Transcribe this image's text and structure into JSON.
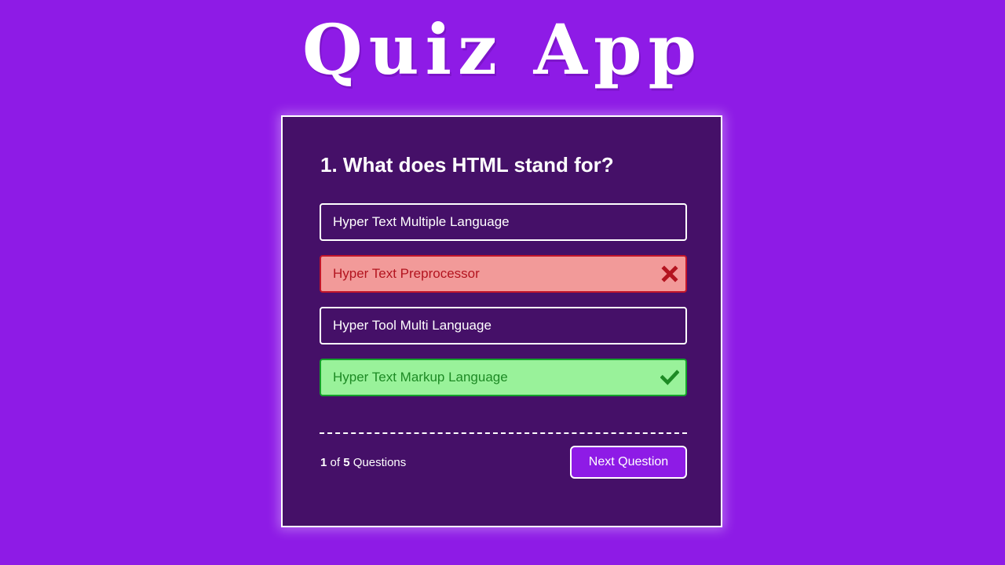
{
  "app": {
    "title": "Quiz App"
  },
  "question": {
    "text": "1. What does HTML stand for?"
  },
  "options": [
    {
      "label": "Hyper Text Multiple Language",
      "state": "neutral"
    },
    {
      "label": "Hyper Text Preprocessor",
      "state": "incorrect",
      "icon": "x-mark-icon"
    },
    {
      "label": "Hyper Tool Multi Language",
      "state": "neutral"
    },
    {
      "label": "Hyper Text Markup Language",
      "state": "correct",
      "icon": "check-mark-icon"
    }
  ],
  "footer": {
    "current": "1",
    "of_word": "of",
    "total": "5",
    "questions_word": "Questions",
    "next_label": "Next Question"
  },
  "colors": {
    "background": "#8e1be6",
    "card": "#451068",
    "incorrect_fill": "#f29a99",
    "incorrect_border": "#c2152a",
    "correct_fill": "#99f29a",
    "correct_border": "#14a22a"
  }
}
